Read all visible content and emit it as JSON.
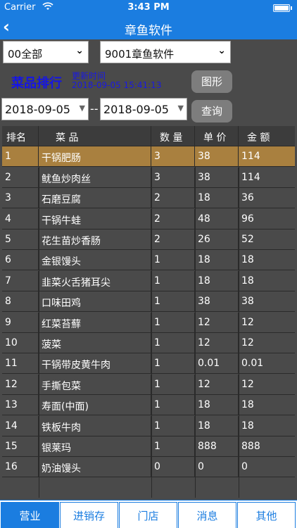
{
  "status": {
    "carrier": "Carrier",
    "time": "3:43 PM"
  },
  "nav": {
    "title": "章鱼软件"
  },
  "filters": {
    "store": "00全部",
    "company": "9001章鱼软件",
    "start_date": "2018-09-05",
    "end_date": "2018-09-05",
    "separator": "--"
  },
  "section": {
    "title": "菜品排行",
    "update_label": "更新时间",
    "update_time": "2018-09-05 15:41:13"
  },
  "buttons": {
    "chart": "图形",
    "query": "查询"
  },
  "table": {
    "headers": [
      "排名",
      "菜 品",
      "数 量",
      "单 价",
      "金 额"
    ],
    "rows": [
      [
        "1",
        "干锅肥肠",
        "3",
        "38",
        "114"
      ],
      [
        "2",
        "鱿鱼炒肉丝",
        "3",
        "38",
        "114"
      ],
      [
        "3",
        "石磨豆腐",
        "2",
        "18",
        "36"
      ],
      [
        "4",
        "干锅牛蛙",
        "2",
        "48",
        "96"
      ],
      [
        "5",
        "花生苗炒香肠",
        "2",
        "26",
        "52"
      ],
      [
        "6",
        "金银馒头",
        "1",
        "18",
        "18"
      ],
      [
        "7",
        "韭菜火舌猪耳尖",
        "1",
        "18",
        "18"
      ],
      [
        "8",
        "口味田鸡",
        "1",
        "38",
        "38"
      ],
      [
        "9",
        "红菜苔蘚",
        "1",
        "12",
        "12"
      ],
      [
        "10",
        "菠菜",
        "1",
        "12",
        "12"
      ],
      [
        "11",
        "干锅带皮黄牛肉",
        "1",
        "0.01",
        "0.01"
      ],
      [
        "12",
        "手撕包菜",
        "1",
        "12",
        "12"
      ],
      [
        "13",
        "寿面(中面)",
        "1",
        "18",
        "18"
      ],
      [
        "14",
        "铁板牛肉",
        "1",
        "18",
        "18"
      ],
      [
        "15",
        "银莱玛",
        "1",
        "888",
        "888"
      ],
      [
        "16",
        "奶油馒头",
        "0",
        "0",
        "0"
      ]
    ]
  },
  "tabs": [
    "营业",
    "进销存",
    "门店",
    "消息",
    "其他"
  ],
  "colors": {
    "accent": "#1b7de0",
    "selected_row": "#a9803f",
    "title_blue": "#1515e6"
  }
}
